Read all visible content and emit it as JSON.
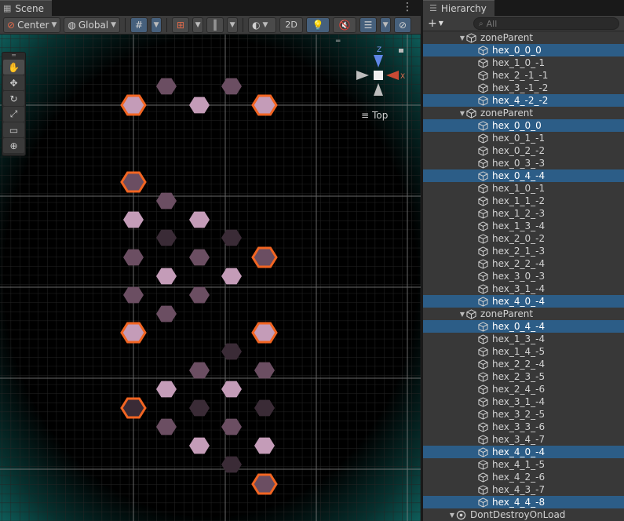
{
  "scene_panel": {
    "tab_label": "Scene",
    "toolbar": {
      "pivot_label": "Center",
      "space_label": "Global",
      "mode_2d_label": "2D"
    },
    "view_label": "Top",
    "gizmo_axes": {
      "up": "Z",
      "right": "X"
    }
  },
  "hierarchy_panel": {
    "tab_label": "Hierarchy",
    "search_placeholder": "All",
    "rows": [
      {
        "label": "zoneParent",
        "depth": 0,
        "selected": false,
        "parent": true
      },
      {
        "label": "hex_0_0_0",
        "depth": 1,
        "selected": true
      },
      {
        "label": "hex_1_0_-1",
        "depth": 1,
        "selected": false
      },
      {
        "label": "hex_2_-1_-1",
        "depth": 1,
        "selected": false
      },
      {
        "label": "hex_3_-1_-2",
        "depth": 1,
        "selected": false
      },
      {
        "label": "hex_4_-2_-2",
        "depth": 1,
        "selected": true
      },
      {
        "label": "zoneParent",
        "depth": 0,
        "selected": false,
        "parent": true
      },
      {
        "label": "hex_0_0_0",
        "depth": 1,
        "selected": true
      },
      {
        "label": "hex_0_1_-1",
        "depth": 1,
        "selected": false
      },
      {
        "label": "hex_0_2_-2",
        "depth": 1,
        "selected": false
      },
      {
        "label": "hex_0_3_-3",
        "depth": 1,
        "selected": false
      },
      {
        "label": "hex_0_4_-4",
        "depth": 1,
        "selected": true
      },
      {
        "label": "hex_1_0_-1",
        "depth": 1,
        "selected": false
      },
      {
        "label": "hex_1_1_-2",
        "depth": 1,
        "selected": false
      },
      {
        "label": "hex_1_2_-3",
        "depth": 1,
        "selected": false
      },
      {
        "label": "hex_1_3_-4",
        "depth": 1,
        "selected": false
      },
      {
        "label": "hex_2_0_-2",
        "depth": 1,
        "selected": false
      },
      {
        "label": "hex_2_1_-3",
        "depth": 1,
        "selected": false
      },
      {
        "label": "hex_2_2_-4",
        "depth": 1,
        "selected": false
      },
      {
        "label": "hex_3_0_-3",
        "depth": 1,
        "selected": false
      },
      {
        "label": "hex_3_1_-4",
        "depth": 1,
        "selected": false
      },
      {
        "label": "hex_4_0_-4",
        "depth": 1,
        "selected": true
      },
      {
        "label": "zoneParent",
        "depth": 0,
        "selected": false,
        "parent": true
      },
      {
        "label": "hex_0_4_-4",
        "depth": 1,
        "selected": true
      },
      {
        "label": "hex_1_3_-4",
        "depth": 1,
        "selected": false
      },
      {
        "label": "hex_1_4_-5",
        "depth": 1,
        "selected": false
      },
      {
        "label": "hex_2_2_-4",
        "depth": 1,
        "selected": false
      },
      {
        "label": "hex_2_3_-5",
        "depth": 1,
        "selected": false
      },
      {
        "label": "hex_2_4_-6",
        "depth": 1,
        "selected": false
      },
      {
        "label": "hex_3_1_-4",
        "depth": 1,
        "selected": false
      },
      {
        "label": "hex_3_2_-5",
        "depth": 1,
        "selected": false
      },
      {
        "label": "hex_3_3_-6",
        "depth": 1,
        "selected": false
      },
      {
        "label": "hex_3_4_-7",
        "depth": 1,
        "selected": false
      },
      {
        "label": "hex_4_0_-4",
        "depth": 1,
        "selected": true
      },
      {
        "label": "hex_4_1_-5",
        "depth": 1,
        "selected": false
      },
      {
        "label": "hex_4_2_-6",
        "depth": 1,
        "selected": false
      },
      {
        "label": "hex_4_3_-7",
        "depth": 1,
        "selected": false
      },
      {
        "label": "hex_4_4_-8",
        "depth": 1,
        "selected": true
      },
      {
        "label": "DontDestroyOnLoad",
        "depth": -1,
        "selected": false,
        "scene": true
      }
    ]
  },
  "colors": {
    "selection_outline": "#f26522",
    "hex_light": "#c49cb8",
    "hex_mid": "#6b4e62",
    "hex_dark": "#3a2b36",
    "hierarchy_selected": "#2c5d87",
    "axis_z": "#6a8de0",
    "axis_x": "#d0533c"
  }
}
